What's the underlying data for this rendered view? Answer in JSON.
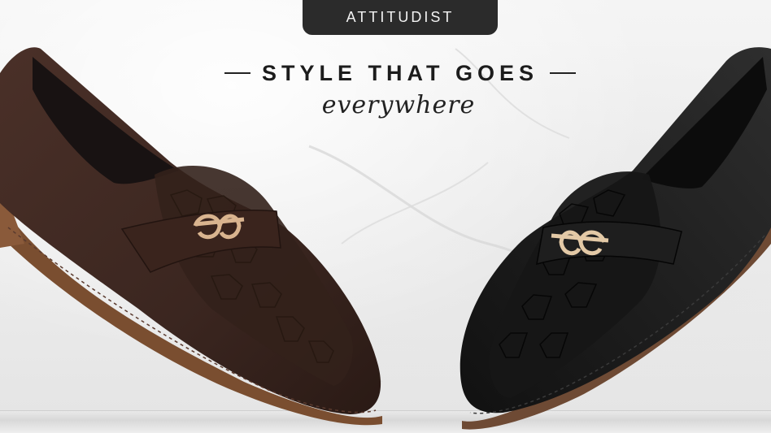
{
  "brand": {
    "name": "ATTITUDIST"
  },
  "headline": {
    "main": "STYLE THAT GOES",
    "script": "everywhere"
  },
  "products": [
    {
      "name": "brown-loafer",
      "color": "#3b2620"
    },
    {
      "name": "black-loafer",
      "color": "#1c1c1c"
    }
  ],
  "colors": {
    "badge": "#2b2b2b",
    "text": "#1c1c1c",
    "hardware": "#d9b48f"
  }
}
